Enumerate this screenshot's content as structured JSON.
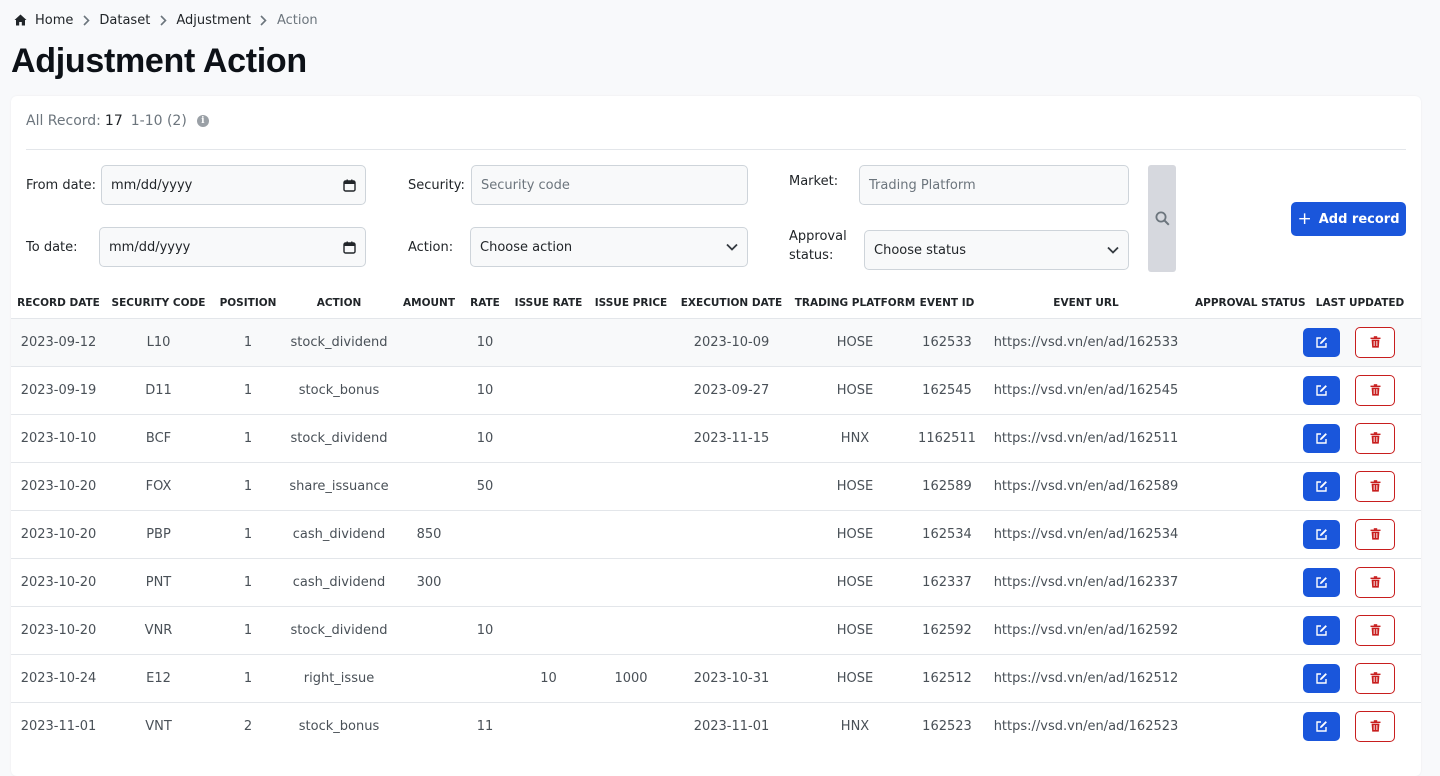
{
  "breadcrumb": {
    "items": [
      {
        "label": "Home",
        "icon": "home-icon"
      },
      {
        "label": "Dataset"
      },
      {
        "label": "Adjustment"
      },
      {
        "label": "Action"
      }
    ]
  },
  "page": {
    "title": "Adjustment Action"
  },
  "summary": {
    "label": "All Record:",
    "count": "17",
    "range": "1-10 (2)",
    "info_icon": "info-icon"
  },
  "filters": {
    "from_date": {
      "label": "From date:",
      "placeholder": "mm/dd/yyyy"
    },
    "to_date": {
      "label": "To date:",
      "placeholder": "mm/dd/yyyy"
    },
    "security": {
      "label": "Security:",
      "placeholder": "Security code"
    },
    "action": {
      "label": "Action:",
      "value": "Choose action"
    },
    "market": {
      "label": "Market:",
      "placeholder": "Trading Platform"
    },
    "approval": {
      "label_line1": "Approval",
      "label_line2": "status:",
      "value": "Choose status"
    },
    "search_icon": "search-icon"
  },
  "add_button": {
    "label": "Add record",
    "icon": "plus-icon"
  },
  "colors": {
    "primary": "#1a56db",
    "danger": "#c81e1e",
    "page_bg": "#f8f9fb"
  },
  "table": {
    "columns": [
      "RECORD DATE",
      "SECURITY CODE",
      "POSITION",
      "ACTION",
      "AMOUNT",
      "RATE",
      "ISSUE RATE",
      "ISSUE PRICE",
      "EXECUTION DATE",
      "TRADING PLATFORM",
      "EVENT ID",
      "EVENT URL",
      "APPROVAL STATUS",
      "LAST UPDATED"
    ],
    "rows": [
      [
        "2023-09-12",
        "L10",
        "1",
        "stock_dividend",
        "",
        "10",
        "",
        "",
        "2023-10-09",
        "HOSE",
        "162533",
        "https://vsd.vn/en/ad/162533",
        ""
      ],
      [
        "2023-09-19",
        "D11",
        "1",
        "stock_bonus",
        "",
        "10",
        "",
        "",
        "2023-09-27",
        "HOSE",
        "162545",
        "https://vsd.vn/en/ad/162545",
        ""
      ],
      [
        "2023-10-10",
        "BCF",
        "1",
        "stock_dividend",
        "",
        "10",
        "",
        "",
        "2023-11-15",
        "HNX",
        "1162511",
        "https://vsd.vn/en/ad/162511",
        ""
      ],
      [
        "2023-10-20",
        "FOX",
        "1",
        "share_issuance",
        "",
        "50",
        "",
        "",
        "",
        "HOSE",
        "162589",
        "https://vsd.vn/en/ad/162589",
        ""
      ],
      [
        "2023-10-20",
        "PBP",
        "1",
        "cash_dividend",
        "850",
        "",
        "",
        "",
        "",
        "HOSE",
        "162534",
        "https://vsd.vn/en/ad/162534",
        ""
      ],
      [
        "2023-10-20",
        "PNT",
        "1",
        "cash_dividend",
        "300",
        "",
        "",
        "",
        "",
        "HOSE",
        "162337",
        "https://vsd.vn/en/ad/162337",
        ""
      ],
      [
        "2023-10-20",
        "VNR",
        "1",
        "stock_dividend",
        "",
        "10",
        "",
        "",
        "",
        "HOSE",
        "162592",
        "https://vsd.vn/en/ad/162592",
        ""
      ],
      [
        "2023-10-24",
        "E12",
        "1",
        "right_issue",
        "",
        "",
        "10",
        "1000",
        "2023-10-31",
        "HOSE",
        "162512",
        "https://vsd.vn/en/ad/162512",
        ""
      ],
      [
        "2023-11-01",
        "VNT",
        "2",
        "stock_bonus",
        "",
        "11",
        "",
        "",
        "2023-11-01",
        "HNX",
        "162523",
        "https://vsd.vn/en/ad/162523",
        ""
      ]
    ],
    "row_actions": {
      "edit_icon": "edit-icon",
      "delete_icon": "trash-icon"
    }
  }
}
